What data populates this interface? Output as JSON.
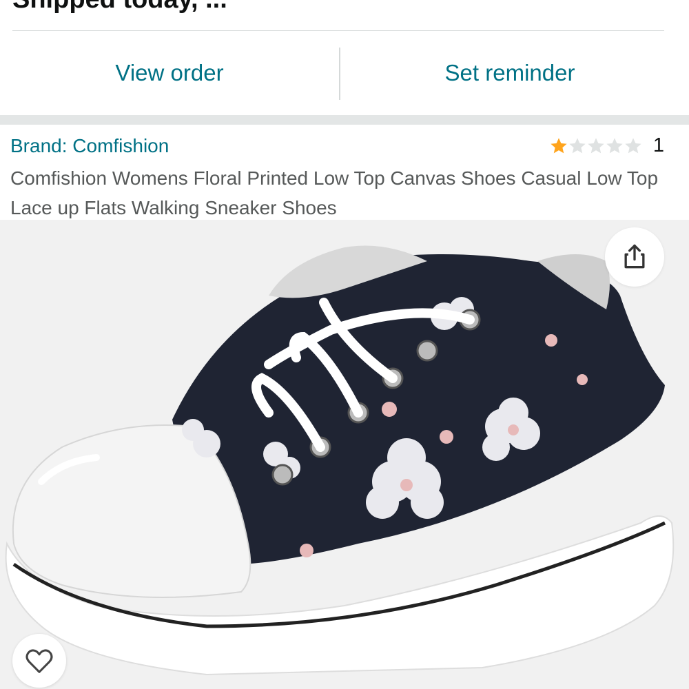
{
  "order": {
    "heading_partial": "Shipped today, ..."
  },
  "actions": {
    "view_order": "View order",
    "set_reminder": "Set reminder"
  },
  "product": {
    "brand": "Brand: Comfishion",
    "rating_count": "1",
    "rating_value": 1,
    "rating_max": 5,
    "title": "Comfishion Womens Floral Printed Low Top Canvas Shoes Casual Low Top Lace up Flats Walking Sneaker Shoes",
    "image_description_icon": "product-image"
  },
  "colors": {
    "link": "#007185",
    "star_filled": "#ffa41c",
    "star_empty": "#d5d9d9",
    "text_primary": "#0f1111",
    "text_secondary": "#565959",
    "divider": "#d5d9d9",
    "image_bg": "#f1f1f1"
  },
  "icons": {
    "share": "share-icon",
    "wishlist": "heart-outline-icon"
  }
}
